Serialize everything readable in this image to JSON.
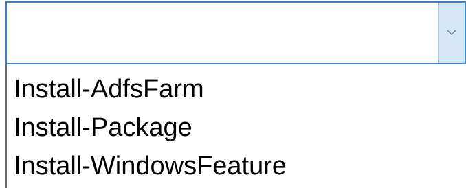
{
  "combo": {
    "value": "",
    "arrow_icon": "chevron-down-icon",
    "border_color": "#3c7fc4",
    "button_color": "#d5e6f6"
  },
  "dropdown": {
    "options": [
      "Install-AdfsFarm",
      "Install-Package",
      "Install-WindowsFeature"
    ]
  }
}
